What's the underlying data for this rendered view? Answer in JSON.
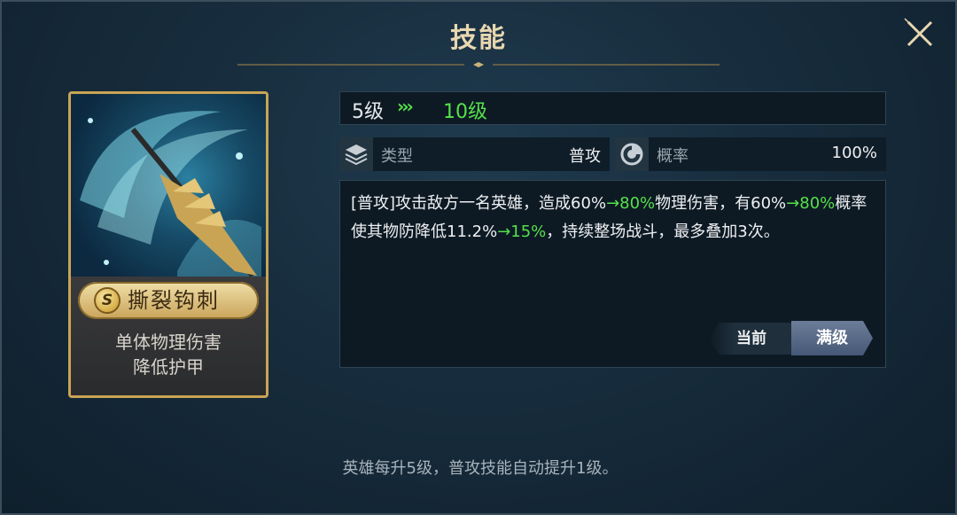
{
  "window": {
    "title": "技能"
  },
  "icons": {
    "close": "close-icon",
    "stack": "layers-icon",
    "rate": "pie-chart-icon",
    "grade": "s-grade-badge"
  },
  "colors": {
    "highlight": "#56e04b",
    "gold": "#c9a455",
    "accent_tab": "#5b6c8a"
  },
  "card": {
    "grade": "S",
    "name": "撕裂钩刺",
    "desc_line1": "单体物理伤害",
    "desc_line2": "降低护甲"
  },
  "level": {
    "from": "5级",
    "arrows": "›››",
    "to": "10级"
  },
  "stats": {
    "type_label": "类型",
    "type_value": "普攻",
    "rate_label": "概率",
    "rate_value": "100%"
  },
  "description": {
    "p1": "[普攻]攻击敌方一名英雄，造成60%",
    "h1": "→80%",
    "p2": "物理伤害，有60%",
    "h2": "→80%",
    "p3": "概率使其物防降低11.2%",
    "h3": "→15%",
    "p4": "，持续整场战斗，最多叠加3次。"
  },
  "tabs": {
    "current": "当前",
    "full": "满级",
    "selected": "满级"
  },
  "footer": {
    "note": "英雄每升5级，普攻技能自动提升1级。"
  }
}
